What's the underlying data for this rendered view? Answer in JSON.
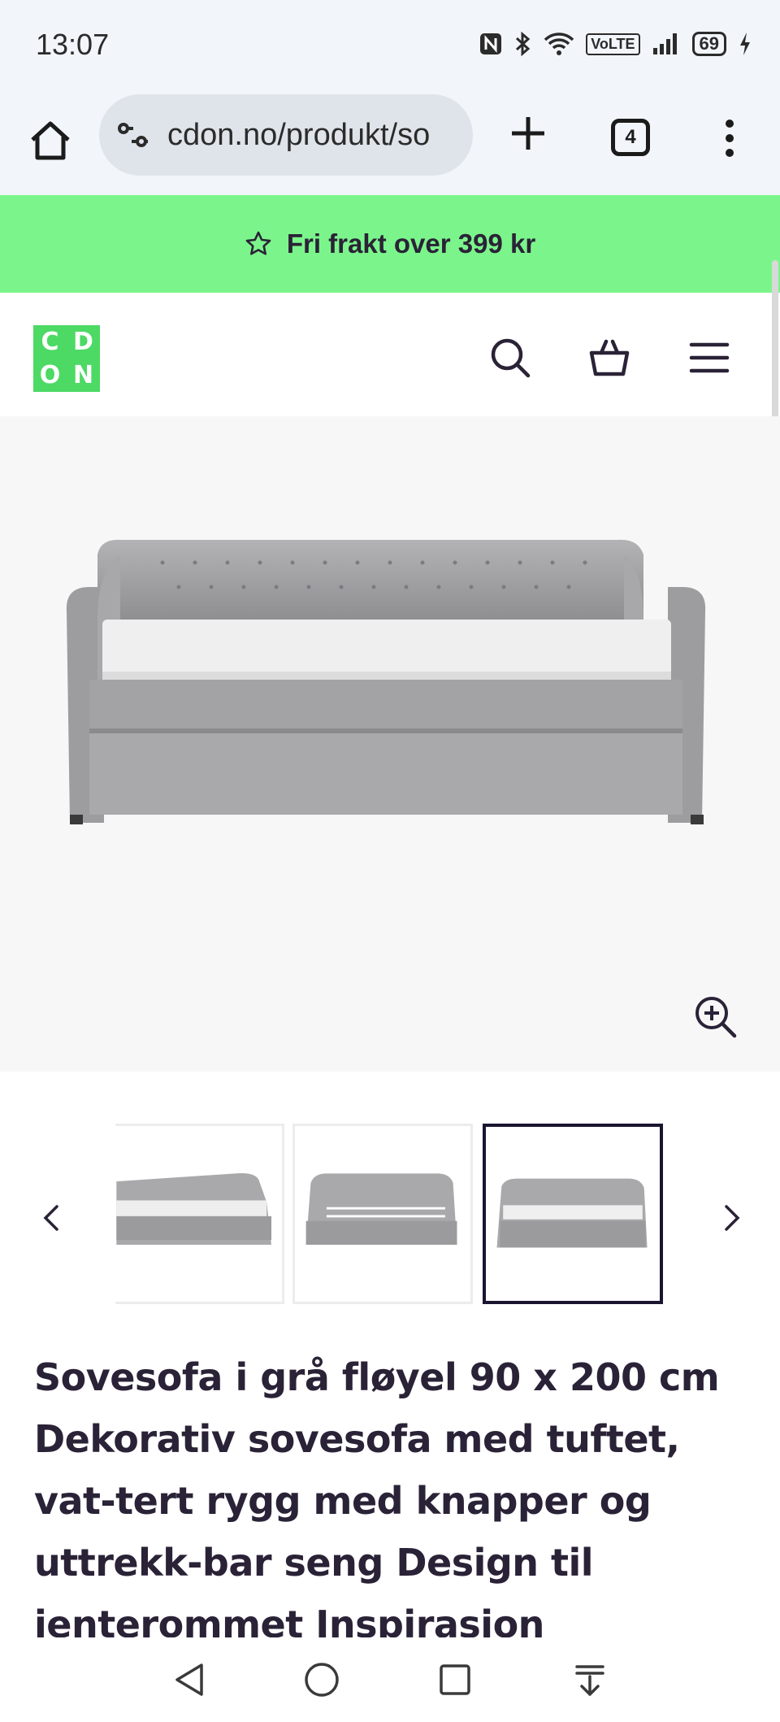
{
  "status_bar": {
    "time": "13:07",
    "icons": [
      "nfc-icon",
      "bluetooth-icon",
      "wifi-icon",
      "volte-icon",
      "signal-icon",
      "battery-icon",
      "charging-icon"
    ],
    "volte_label": "VoLTE",
    "battery_level": "69"
  },
  "browser": {
    "url": "cdon.no/produkt/so",
    "tab_count": "4"
  },
  "promo": {
    "text": "Fri frakt over 399 kr",
    "color": "#7bf58b"
  },
  "site_header": {
    "logo_letters": [
      "C",
      "D",
      "O",
      "N"
    ],
    "logo_color": "#4cd964",
    "icons": [
      "search-icon",
      "basket-icon",
      "hamburger-menu-icon"
    ]
  },
  "product": {
    "title": "Sovesofa i grå fløyel 90 x 200 cm Dekorativ sovesofa med tuftet, vat-tert rygg med knapper og uttrekk-bar seng Design til jenterommet Inspirasjon",
    "thumbnails": [
      "thumbnail-1",
      "thumbnail-2",
      "thumbnail-3"
    ],
    "active_thumbnail": 3
  },
  "nav_bar": {
    "icons": [
      "back-triangle-icon",
      "home-circle-icon",
      "recents-square-icon",
      "download-arrow-icon"
    ]
  }
}
